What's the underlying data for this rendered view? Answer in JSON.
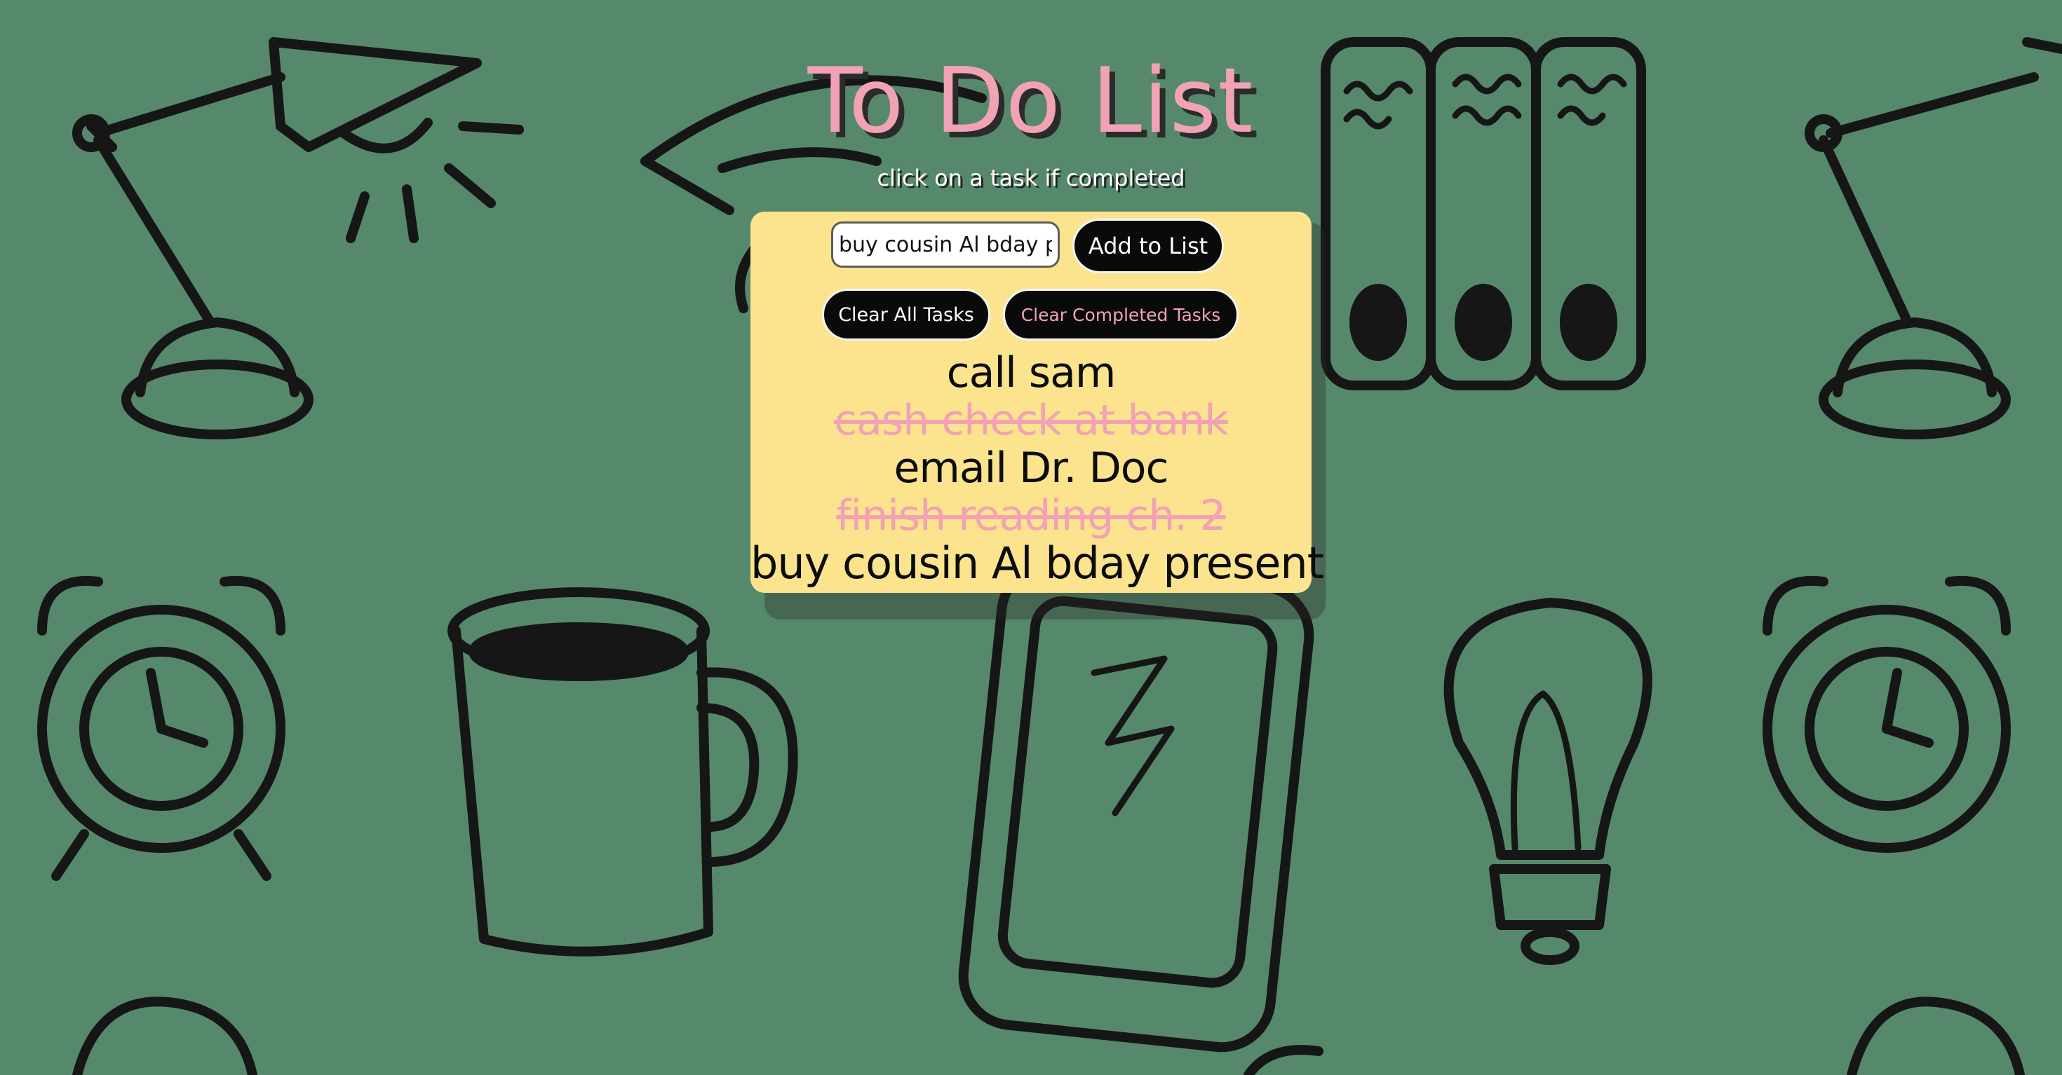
{
  "header": {
    "title": "To Do List",
    "subtitle": "click on a task if completed"
  },
  "form": {
    "input_value": "buy cousin Al bday present",
    "add_button": "Add to List"
  },
  "actions": {
    "clear_all": "Clear All Tasks",
    "clear_completed": "Clear Completed Tasks"
  },
  "tasks": [
    {
      "text": "call sam",
      "completed": false
    },
    {
      "text": "cash check at bank",
      "completed": true
    },
    {
      "text": "email Dr. Doc",
      "completed": false
    },
    {
      "text": "finish reading ch. 2",
      "completed": true
    },
    {
      "text": "buy cousin Al bday present",
      "completed": false
    }
  ],
  "colors": {
    "background": "#56896b",
    "card": "#fbe48d",
    "accent_pink": "#f2a2b5",
    "button": "#0a0a0a"
  },
  "background_icons": [
    "desk-lamp-icon",
    "binders-icon",
    "graduation-cap-icon",
    "alarm-clock-icon",
    "coffee-mug-icon",
    "smartphone-icon",
    "lightbulb-icon"
  ]
}
